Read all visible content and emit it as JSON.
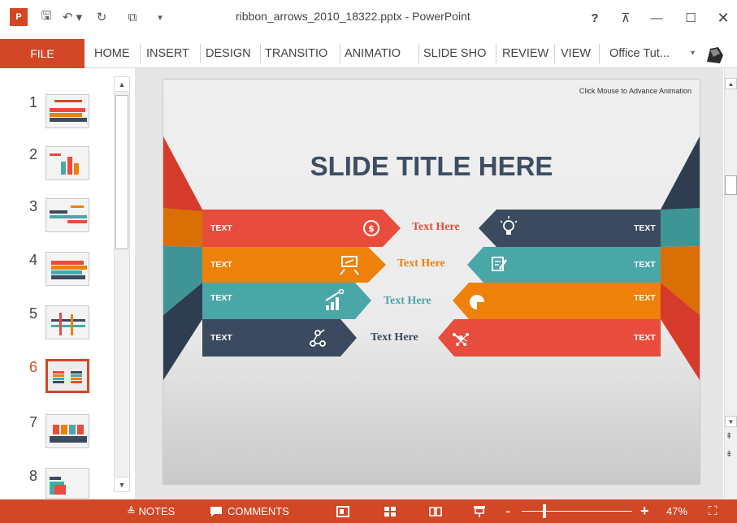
{
  "window": {
    "title": "ribbon_arrows_2010_18322.pptx - PowerPoint",
    "app_badge": "P",
    "help": "?",
    "ribbon_options": "⊼",
    "minimize": "—",
    "maximize": "☐",
    "close": "✕"
  },
  "qat": {
    "save": "🖫",
    "undo": "↶ ▾",
    "redo": "↻",
    "present": "⧉",
    "customize": "▾"
  },
  "tabs": [
    {
      "label": "HOME"
    },
    {
      "label": "INSERT"
    },
    {
      "label": "DESIGN"
    },
    {
      "label": "TRANSITIO"
    },
    {
      "label": "ANIMATIO"
    },
    {
      "label": "SLIDE SHO"
    },
    {
      "label": "REVIEW"
    },
    {
      "label": "VIEW"
    }
  ],
  "file_tab": "FILE",
  "user": {
    "name": "Office Tut...",
    "chevron": "▾"
  },
  "thumbnails": [
    {
      "num": "1"
    },
    {
      "num": "2"
    },
    {
      "num": "3"
    },
    {
      "num": "4"
    },
    {
      "num": "5"
    },
    {
      "num": "6",
      "active": true
    },
    {
      "num": "7"
    },
    {
      "num": "8"
    }
  ],
  "slide": {
    "hint": "Click Mouse to Advance Animation",
    "title": "SLIDE TITLE HERE",
    "colors": {
      "red": "#e84c3d",
      "orange": "#ee8109",
      "teal": "#4aa7a8",
      "navy": "#3b4a5e"
    },
    "left_bars": [
      {
        "label": "TEXT",
        "color": "#e84c3d",
        "icon": "dollar-icon"
      },
      {
        "label": "TEXT",
        "color": "#ee8109",
        "icon": "presentation-board-icon"
      },
      {
        "label": "TEXT",
        "color": "#4aa7a8",
        "icon": "growth-chart-icon"
      },
      {
        "label": "TEXT",
        "color": "#3b4a5e",
        "icon": "network-icon"
      }
    ],
    "right_bars": [
      {
        "label": "TEXT",
        "color": "#3b4a5e",
        "icon": "lightbulb-icon"
      },
      {
        "label": "TEXT",
        "color": "#4aa7a8",
        "icon": "document-edit-icon"
      },
      {
        "label": "TEXT",
        "color": "#ee8109",
        "icon": "pie-chart-icon"
      },
      {
        "label": "TEXT",
        "color": "#e84c3d",
        "icon": "molecule-icon"
      }
    ],
    "center_texts": [
      {
        "text": "Text Here",
        "color": "#e84c3d"
      },
      {
        "text": "Text Here",
        "color": "#ee8109"
      },
      {
        "text": "Text Here",
        "color": "#4aa7a8"
      },
      {
        "text": "Text Here",
        "color": "#3b4a5e"
      }
    ]
  },
  "statusbar": {
    "notes": "≜ NOTES",
    "comments": "COMMENTS",
    "zoom_level": "47%",
    "zoom_fraction": 0.47,
    "fit": "⛶"
  }
}
